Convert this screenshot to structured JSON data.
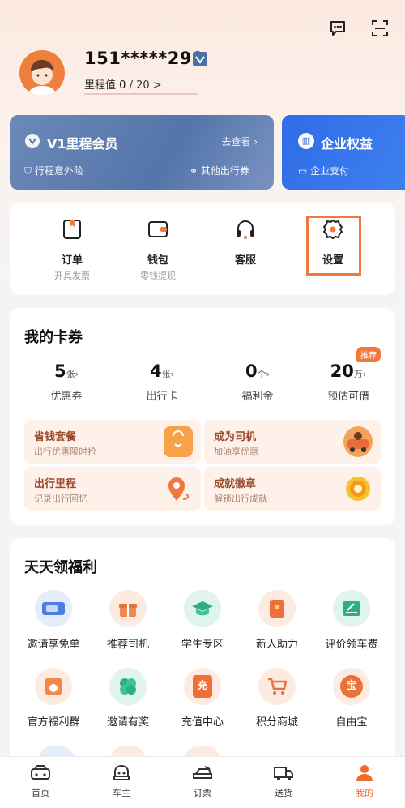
{
  "header": {
    "phone": "151*****299",
    "mileage_label": "里程值",
    "mileage_value": "0",
    "mileage_total": "/ 20",
    "mileage_arrow": ">"
  },
  "member_cards": [
    {
      "title": "V1里程会员",
      "link": "去查看",
      "benefit1": "行程意外险",
      "benefit2": "其他出行券"
    },
    {
      "title": "企业权益",
      "benefit1": "企业支付"
    }
  ],
  "quick_actions": [
    {
      "label": "订单",
      "sub": "开具发票",
      "icon": "order-icon"
    },
    {
      "label": "钱包",
      "sub": "零钱提现",
      "icon": "wallet-icon"
    },
    {
      "label": "客服",
      "sub": "",
      "icon": "headset-icon"
    },
    {
      "label": "设置",
      "sub": "",
      "icon": "gear-icon"
    }
  ],
  "cards_section": {
    "title": "我的卡券",
    "tag": "推荐",
    "stats": [
      {
        "num": "5",
        "unit": "张",
        "label": "优惠券"
      },
      {
        "num": "4",
        "unit": "张",
        "label": "出行卡"
      },
      {
        "num": "0",
        "unit": "个",
        "label": "福利金"
      },
      {
        "num": "20",
        "unit": "万",
        "label": "预估可借"
      }
    ],
    "promos": [
      {
        "title": "省钱套餐",
        "sub": "出行优惠限时抢"
      },
      {
        "title": "成为司机",
        "sub": "加油享优惠"
      },
      {
        "title": "出行里程",
        "sub": "记录出行回忆"
      },
      {
        "title": "成就徽章",
        "sub": "解锁出行成就"
      }
    ]
  },
  "welfare": {
    "title": "天天领福利",
    "items": [
      {
        "label": "邀请享免单",
        "icon": "ticket-icon"
      },
      {
        "label": "推荐司机",
        "icon": "gift-icon"
      },
      {
        "label": "学生专区",
        "icon": "graduation-cap-icon"
      },
      {
        "label": "新人助力",
        "icon": "red-envelope-icon"
      },
      {
        "label": "评价领车费",
        "icon": "review-icon"
      },
      {
        "label": "官方福利群",
        "icon": "chat-group-icon"
      },
      {
        "label": "邀请有奖",
        "icon": "clover-icon"
      },
      {
        "label": "充值中心",
        "icon": "recharge-icon",
        "glyph": "充"
      },
      {
        "label": "积分商城",
        "icon": "cart-icon"
      },
      {
        "label": "自由宝",
        "icon": "treasure-icon",
        "glyph": "宝"
      }
    ]
  },
  "tabbar": [
    {
      "label": "首页",
      "icon": "car-home-icon"
    },
    {
      "label": "车主",
      "icon": "car-owner-icon"
    },
    {
      "label": "订票",
      "icon": "train-ticket-icon"
    },
    {
      "label": "送货",
      "icon": "truck-icon"
    },
    {
      "label": "我的",
      "icon": "profile-icon",
      "active": true
    }
  ],
  "colors": {
    "accent": "#ef6a2c",
    "member_card": "#5f7fb2",
    "enterprise_card": "#3478ec"
  }
}
